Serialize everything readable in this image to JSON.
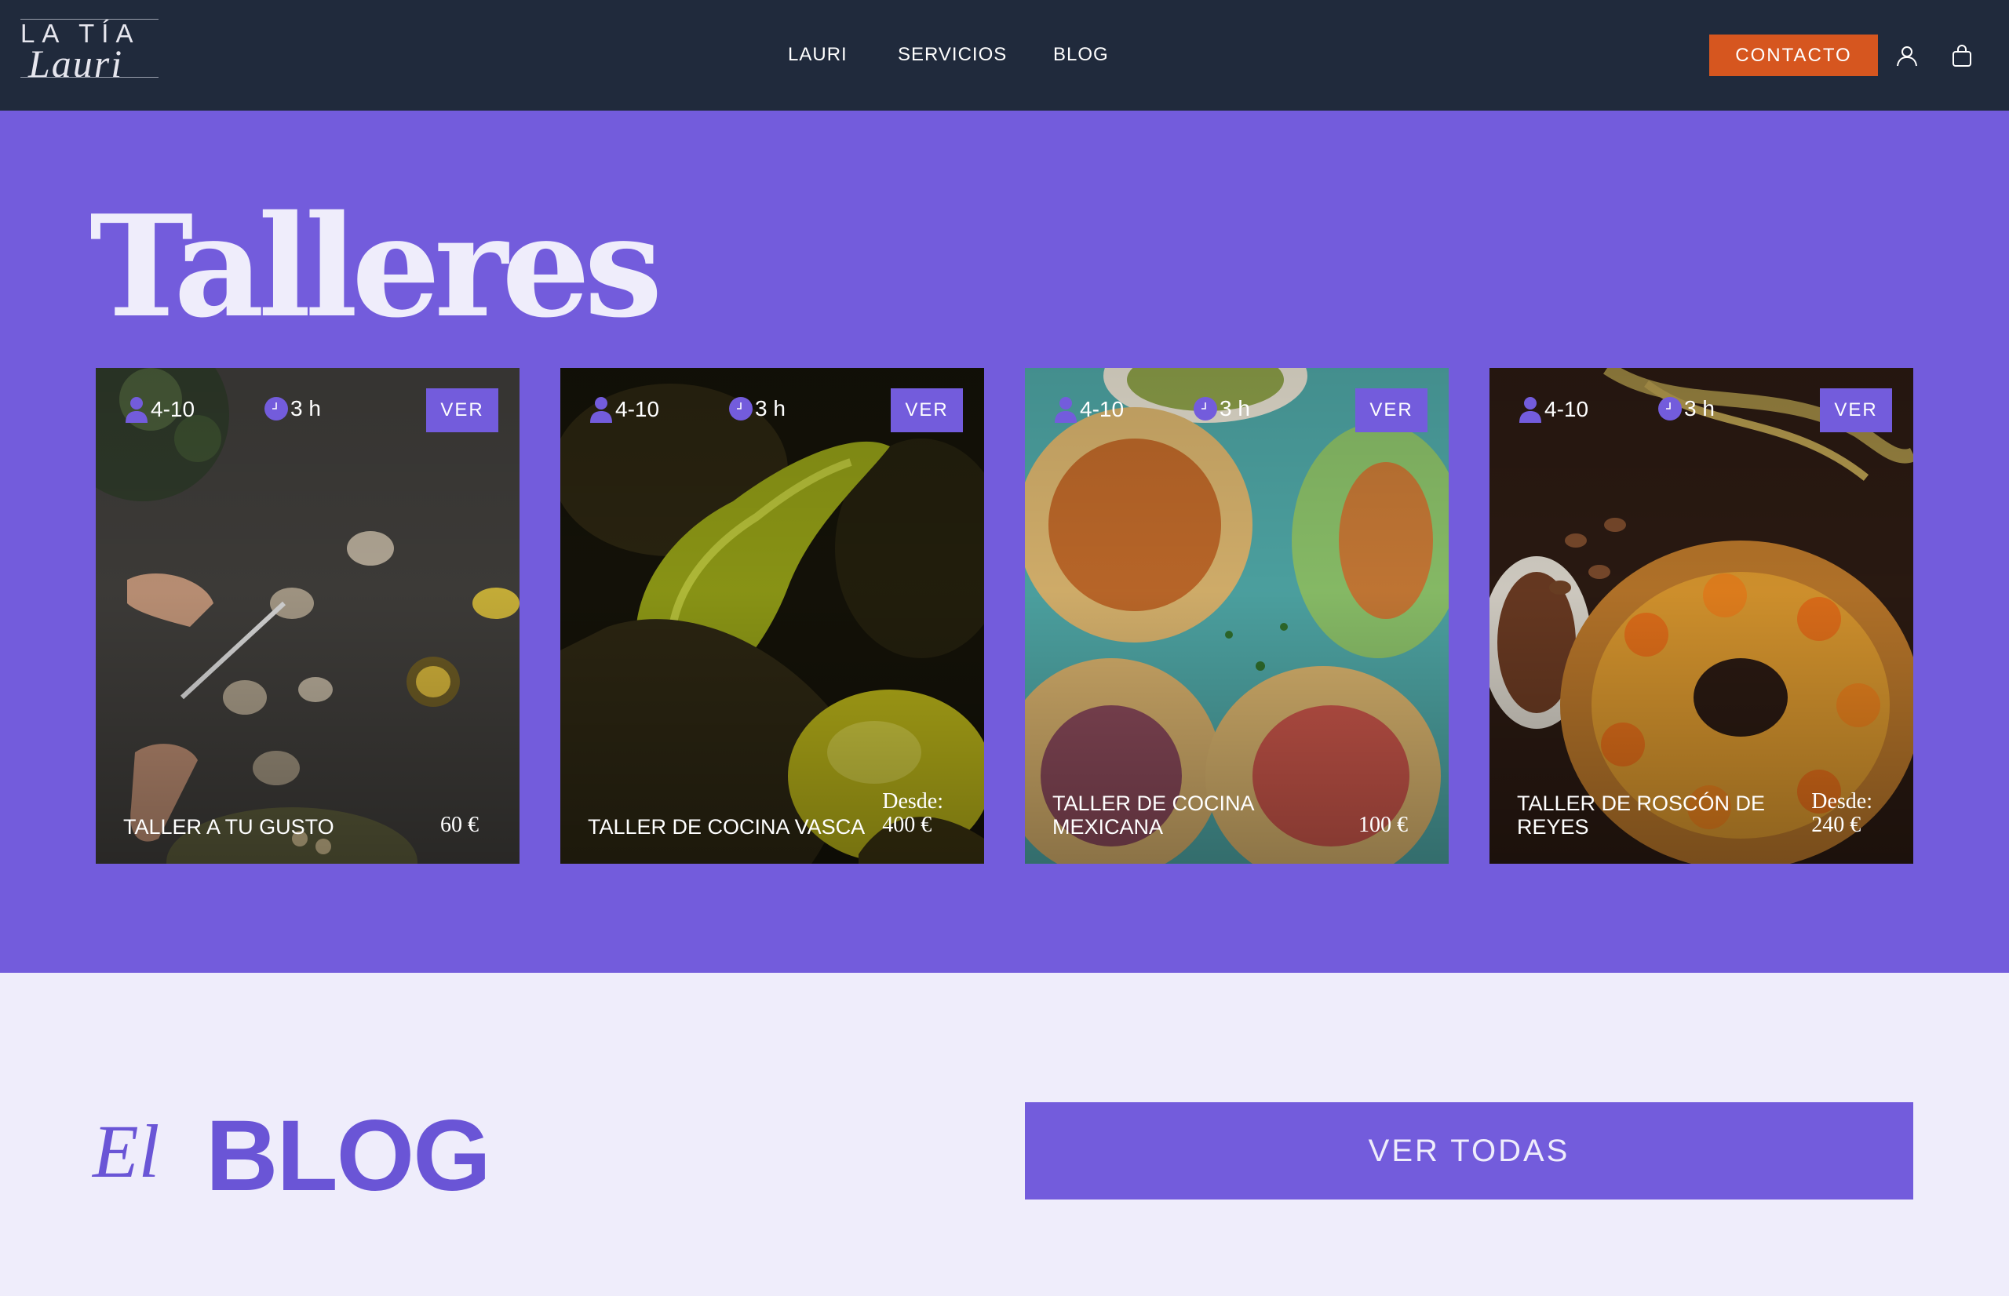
{
  "header": {
    "logo_top": "LA TÍA",
    "logo_bottom": "Lauri",
    "nav": [
      "LAURI",
      "SERVICIOS",
      "BLOG"
    ],
    "contact_label": "CONTACTO"
  },
  "talleres": {
    "title": "Talleres",
    "cards": [
      {
        "people": "4-10",
        "duration": "3 h",
        "button": "VER",
        "title": "TALLER A TU GUSTO",
        "price_prefix": "",
        "price": "60 €"
      },
      {
        "people": "4-10",
        "duration": "3 h",
        "button": "VER",
        "title": "TALLER DE COCINA VASCA",
        "price_prefix": "Desde:",
        "price": "400 €"
      },
      {
        "people": "4-10",
        "duration": "3 h",
        "button": "VER",
        "title": "TALLER DE COCINA MEXICANA",
        "price_prefix": "",
        "price": "100 €"
      },
      {
        "people": "4-10",
        "duration": "3 h",
        "button": "VER",
        "title": "TALLER DE ROSCÓN DE REYES",
        "price_prefix": "Desde:",
        "price": "240 €"
      }
    ]
  },
  "blog": {
    "script": "El",
    "title": "BLOG",
    "button": "VER TODAS"
  },
  "colors": {
    "header_bg": "#202a3c",
    "accent": "#735cdc",
    "contact": "#d6561f",
    "light_bg": "#efedfb"
  }
}
